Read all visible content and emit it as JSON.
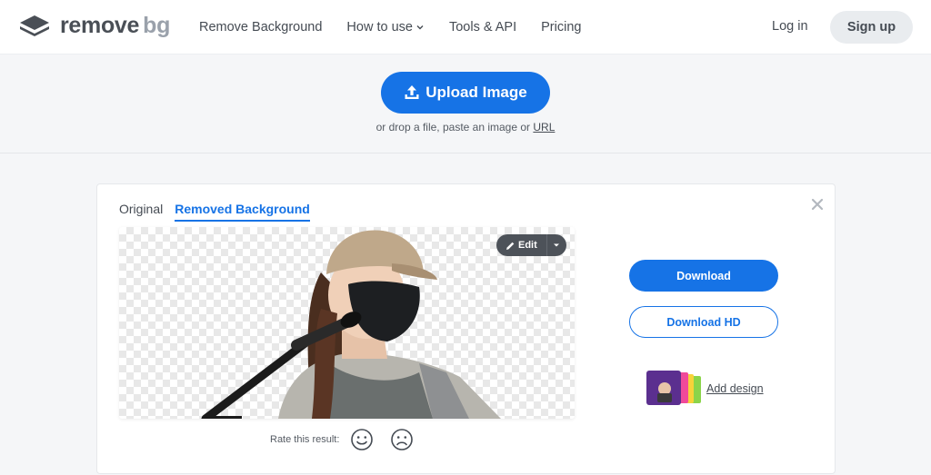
{
  "header": {
    "logo_word": "remove",
    "logo_suffix": "bg",
    "nav": [
      {
        "label": "Remove Background"
      },
      {
        "label": "How to use"
      },
      {
        "label": "Tools & API"
      },
      {
        "label": "Pricing"
      }
    ],
    "login_label": "Log in",
    "signup_label": "Sign up"
  },
  "upload": {
    "button_label": "Upload Image",
    "drop_text": "or drop a file, paste an image or",
    "url_label": "URL"
  },
  "result": {
    "tabs": [
      {
        "label": "Original",
        "active": false
      },
      {
        "label": "Removed Background",
        "active": true
      }
    ],
    "edit_label": "Edit",
    "rate_label": "Rate this result:",
    "download_label": "Download",
    "download_hd_label": "Download HD",
    "add_design_label": "Add design"
  },
  "colors": {
    "accent": "#1673e6",
    "page_bg": "#f5f6f8",
    "card_bg": "#ffffff",
    "text": "#454b53"
  },
  "icons": {
    "upload": "upload-arrow-icon",
    "edit": "pencil-icon",
    "close": "close-icon",
    "happy": "smiley-face-icon",
    "sad": "sad-face-icon"
  }
}
